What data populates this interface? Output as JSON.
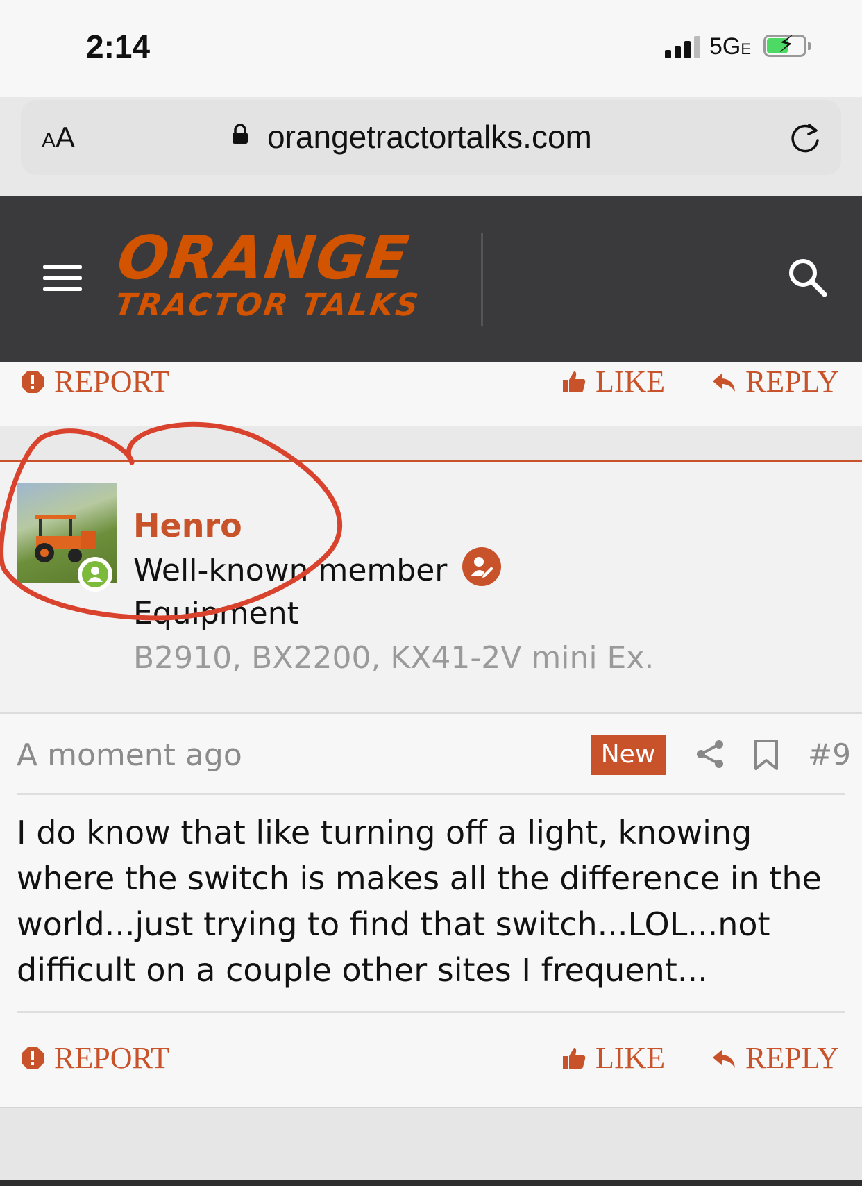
{
  "status_bar": {
    "time": "2:14",
    "network": "5G",
    "network_suffix": "E"
  },
  "browser": {
    "text_size_label_small": "A",
    "text_size_label": "A",
    "url": "orangetractortalks.com"
  },
  "site": {
    "logo_line1": "ORANGE",
    "logo_line2": "TRACTOR TALKS",
    "brand_color": "#d35400"
  },
  "post_actions_top": {
    "report": "REPORT",
    "like": "LIKE",
    "reply": "REPLY"
  },
  "user": {
    "name": "Henro",
    "title": "Well-known member",
    "field_label": "Equipment",
    "field_value": "B2910, BX2200, KX41-2V mini Ex."
  },
  "post": {
    "time": "A moment ago",
    "badge": "New",
    "number": "#9",
    "body": "I do know that like turning off a light, knowing where the switch is makes all the difference in the world...just trying to find that switch...LOL...not difficult on a couple other sites I frequent..."
  },
  "post_actions_bottom": {
    "report": "REPORT",
    "like": "LIKE",
    "reply": "REPLY"
  },
  "annotation_color": "#d9432e"
}
